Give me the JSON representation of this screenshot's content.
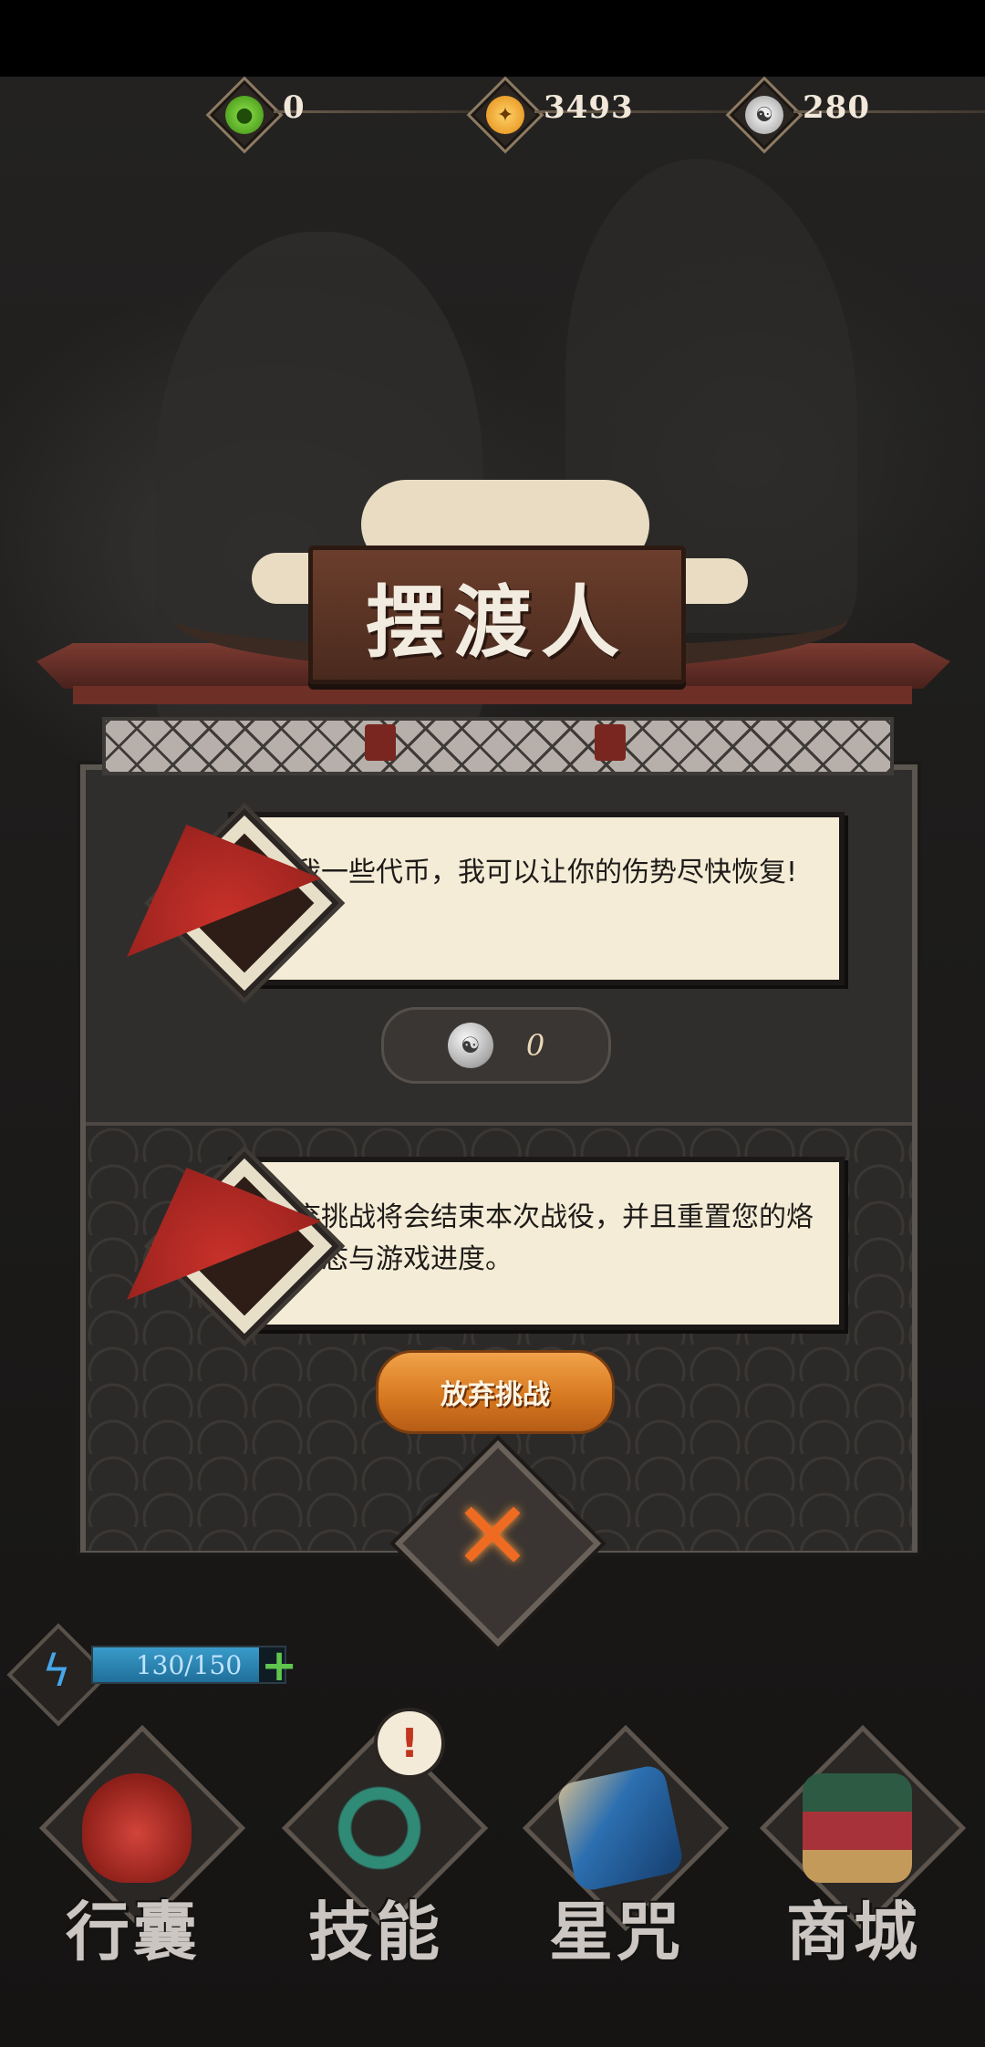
{
  "currencies": [
    {
      "icon": "green-flame-icon",
      "value": "0",
      "color": "#5fbf2e"
    },
    {
      "icon": "gold-star-coin-icon",
      "value": "3493",
      "color": "#f0a524"
    },
    {
      "icon": "silver-yin-yang-coin-icon",
      "value": "280",
      "color": "#bdbdbd"
    }
  ],
  "dialog": {
    "title": "摆渡人",
    "heal_message": "给我一些代币，我可以让你的伤势尽快恢复!",
    "heal_cost": "0",
    "abandon_message": "放弃挑战将会结束本次战役，并且重置您的烙魂状态与游戏进度。",
    "abandon_button": "放弃挑战",
    "close_icon": "close-x-icon"
  },
  "energy": {
    "current": 130,
    "max": 150,
    "text": "130/150",
    "fill_fraction": 0.867
  },
  "nav": [
    {
      "label": "行囊",
      "icon": "bag-icon"
    },
    {
      "label": "技能",
      "icon": "skill-blade-icon",
      "has_alert": true,
      "alert": "!"
    },
    {
      "label": "星咒",
      "icon": "star-scroll-icon"
    },
    {
      "label": "商城",
      "icon": "shop-icon"
    }
  ],
  "colors": {
    "accent_orange": "#e38a2a",
    "panel": "#302e2c",
    "roof_red": "#7b3b31",
    "paper": "#f4ecd6"
  }
}
